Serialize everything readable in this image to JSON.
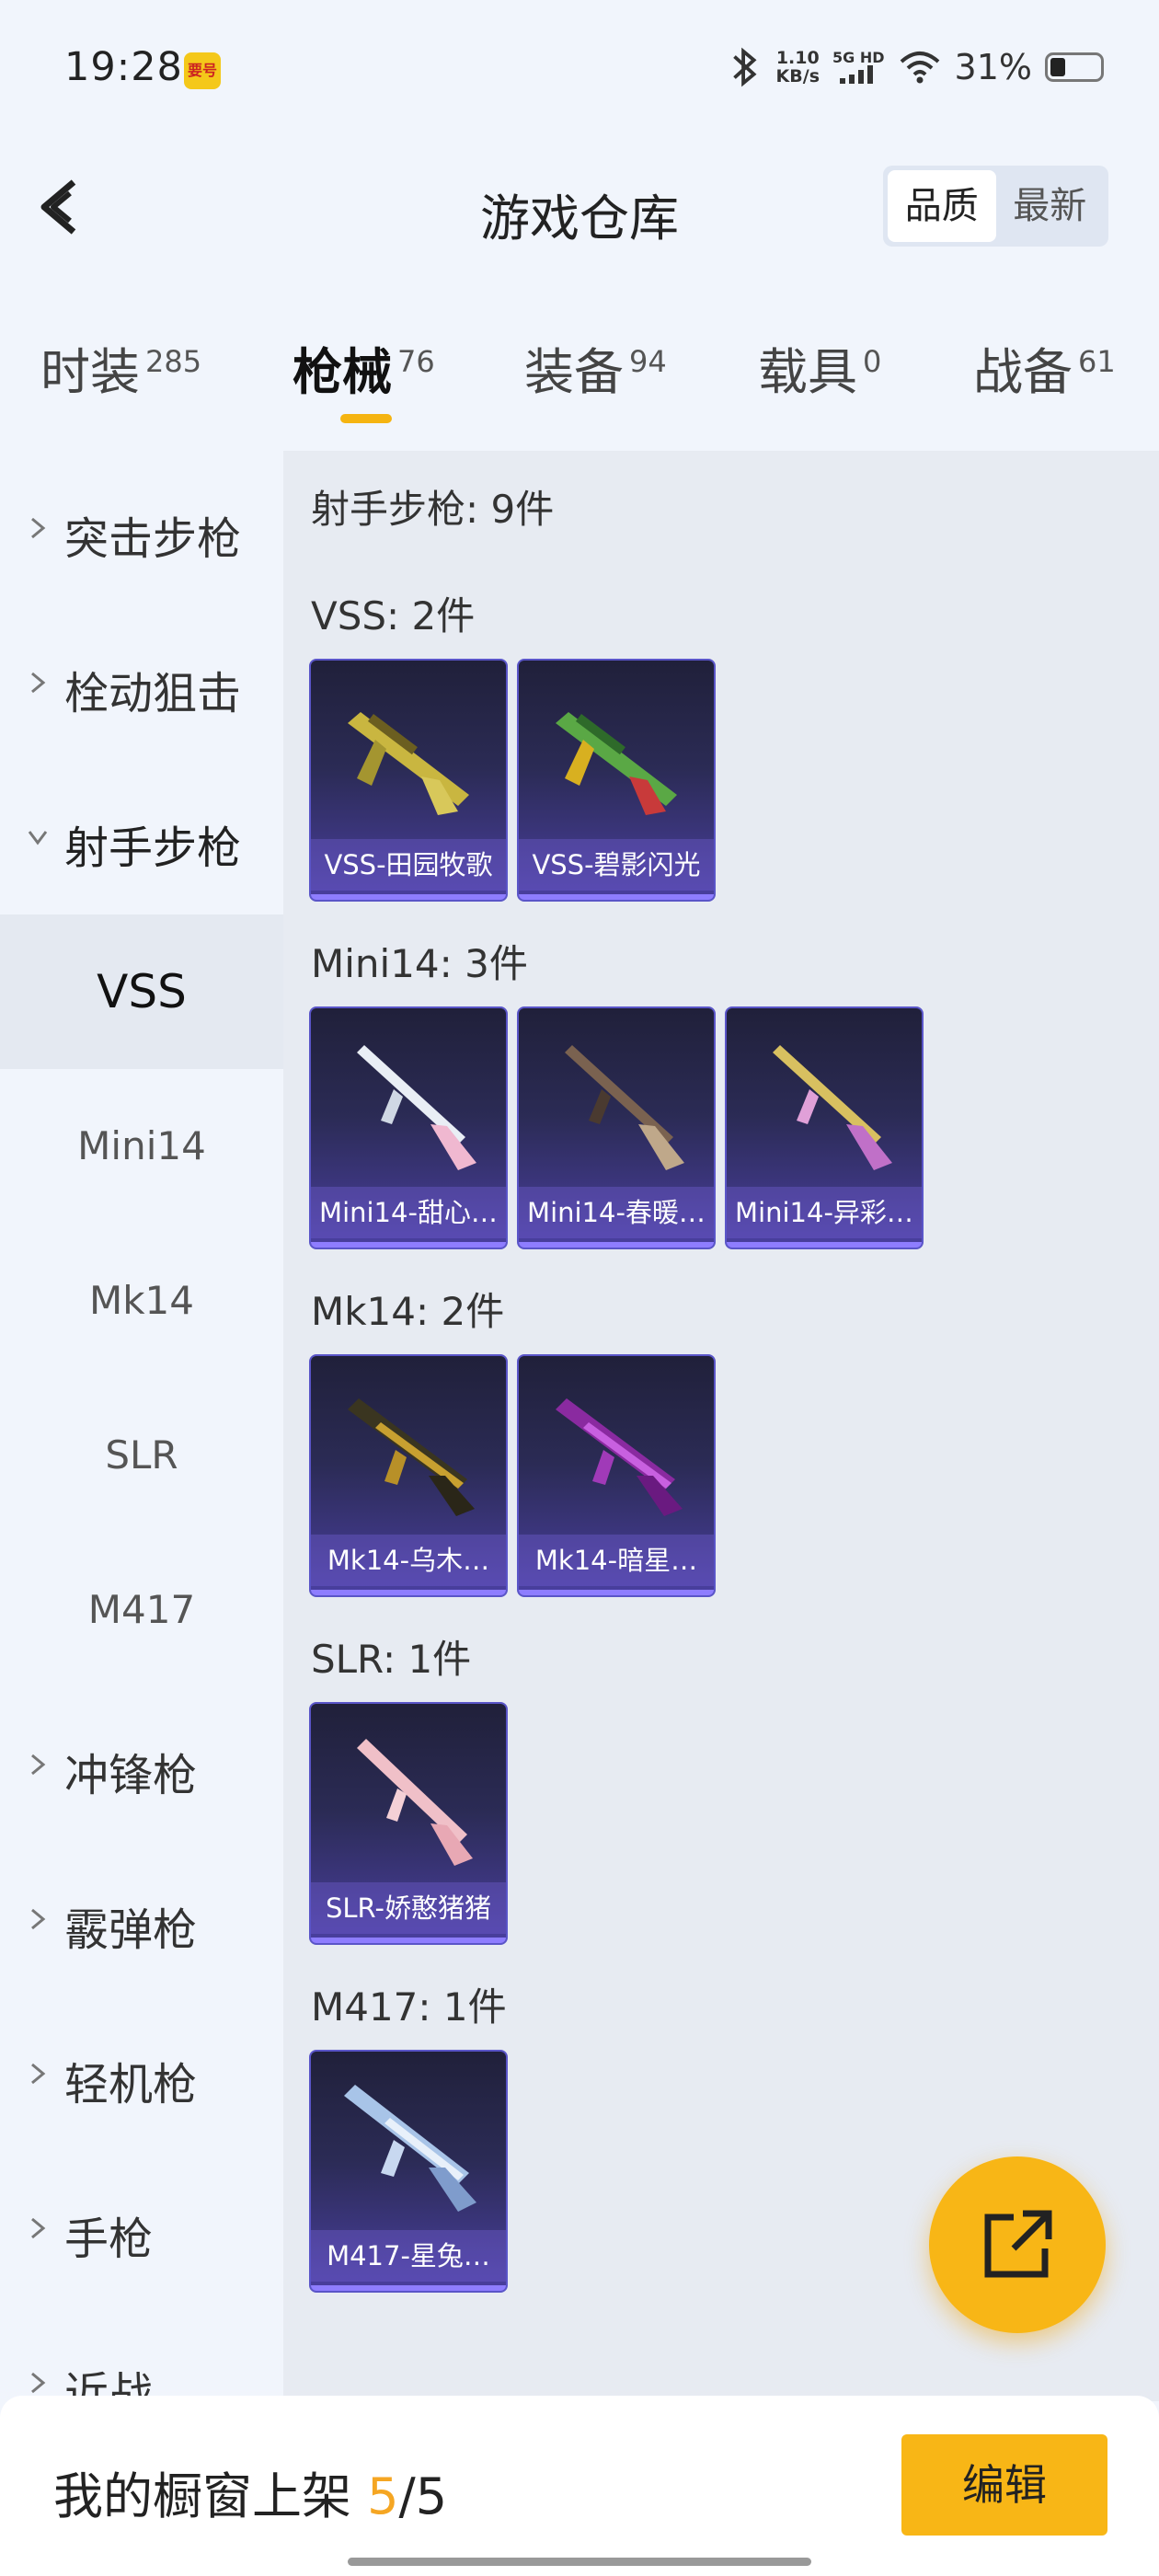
{
  "status_bar": {
    "time": "19:28",
    "app_badge": "要号",
    "net_speed_value": "1.10",
    "net_speed_unit": "KB/s",
    "signal": "5G HD",
    "battery": "31%"
  },
  "header": {
    "title": "游戏仓库",
    "sort_options": [
      "品质",
      "最新"
    ],
    "sort_active": "品质"
  },
  "tabs": [
    {
      "label": "时装",
      "count": "285"
    },
    {
      "label": "枪械",
      "count": "76"
    },
    {
      "label": "装备",
      "count": "94"
    },
    {
      "label": "载具",
      "count": "0"
    },
    {
      "label": "战备",
      "count": "61"
    }
  ],
  "active_tab": "枪械",
  "sidebar": {
    "categories": [
      {
        "label": "突击步枪"
      },
      {
        "label": "栓动狙击"
      },
      {
        "label": "射手步枪"
      },
      {
        "label": "冲锋枪"
      },
      {
        "label": "霰弹枪"
      },
      {
        "label": "轻机枪"
      },
      {
        "label": "手枪"
      },
      {
        "label": "近战"
      }
    ],
    "open_category": "射手步枪",
    "subitems": [
      "VSS",
      "Mini14",
      "Mk14",
      "SLR",
      "M417"
    ],
    "active_subitem": "VSS"
  },
  "content": {
    "summary": "射手步枪: 9件",
    "groups": [
      {
        "title": "VSS: 2件",
        "items": [
          "VSS-田园牧歌",
          "VSS-碧影闪光"
        ]
      },
      {
        "title": "Mini14: 3件",
        "items": [
          "Mini14-甜心…",
          "Mini14-春暖…",
          "Mini14-异彩…"
        ]
      },
      {
        "title": "Mk14: 2件",
        "items": [
          "Mk14-乌木…",
          "Mk14-暗星…"
        ]
      },
      {
        "title": "SLR: 1件",
        "items": [
          "SLR-娇憨猪猪"
        ]
      },
      {
        "title": "M417: 1件",
        "items": [
          "M417-星兔…"
        ]
      }
    ]
  },
  "bottom_bar": {
    "shelf_prefix": "我的橱窗上架 ",
    "shelf_current": "5",
    "shelf_sep": "/",
    "shelf_total": "5",
    "edit_label": "编辑"
  },
  "colors": {
    "accent": "#f8b616",
    "card_border": "#5a55c8",
    "background": "#f1f5fc"
  }
}
